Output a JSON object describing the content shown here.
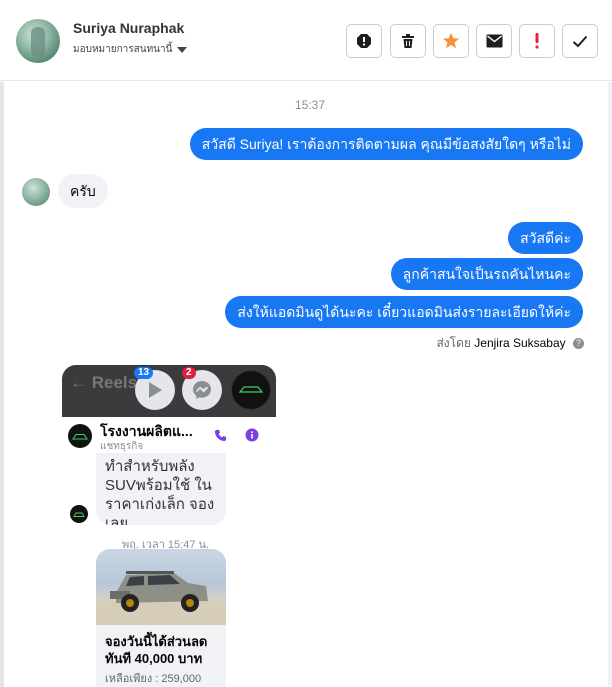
{
  "header": {
    "contact_name": "Suriya Nuraphak",
    "assign_label": "มอบหมายการสนทนานี้"
  },
  "toolbar": {
    "buttons": [
      "report-spam-icon",
      "trash-icon",
      "star-icon",
      "envelope-icon",
      "exclamation-icon",
      "check-icon"
    ]
  },
  "conversation": {
    "timestamp": "15:37",
    "messages": [
      {
        "direction": "out",
        "text": "สวัสดี Suriya! เราต้องการติดตามผล คุณมีข้อสงสัยใดๆ หรือไม่"
      },
      {
        "direction": "in",
        "text": "ครับ"
      },
      {
        "direction": "out",
        "text": "สวัสดีค่ะ"
      },
      {
        "direction": "out",
        "text": "ลูกค้าสนใจเป็นรถคันไหนคะ"
      },
      {
        "direction": "out",
        "text": "ส่งให้แอดมินดูได้นะคะ เดี๋ยวแอดมินส่งรายละเอียดให้ค่ะ"
      }
    ],
    "sent_by_prefix": "ส่งโดย",
    "sent_by_name": "Jenjira Suksabay"
  },
  "attachment": {
    "reels_label": "Reels",
    "badge_reels": "13",
    "badge_messenger": "2",
    "page_name": "โรงงานผลิตแ...",
    "page_subtitle": "แชทธุรกิจ",
    "inner_message": "ทำสำหรับพลัง SUVพร้อมใช้ ใน ราคาเก่งเล็ก จอง เลย...",
    "inner_time": "พฤ. เวลา 15:47 น.",
    "card_title_line1": "จองวันนี้ได้ส่วนลด",
    "card_title_line2": "ทันที 40,000 บาท",
    "card_subtitle": "เหลือเพียง : 259,000"
  },
  "colors": {
    "accent": "#1877f2",
    "incoming_bubble": "#f0f2f5",
    "star": "#f7923b",
    "danger": "#e41e3f",
    "call_purple": "#7b3fe4"
  }
}
